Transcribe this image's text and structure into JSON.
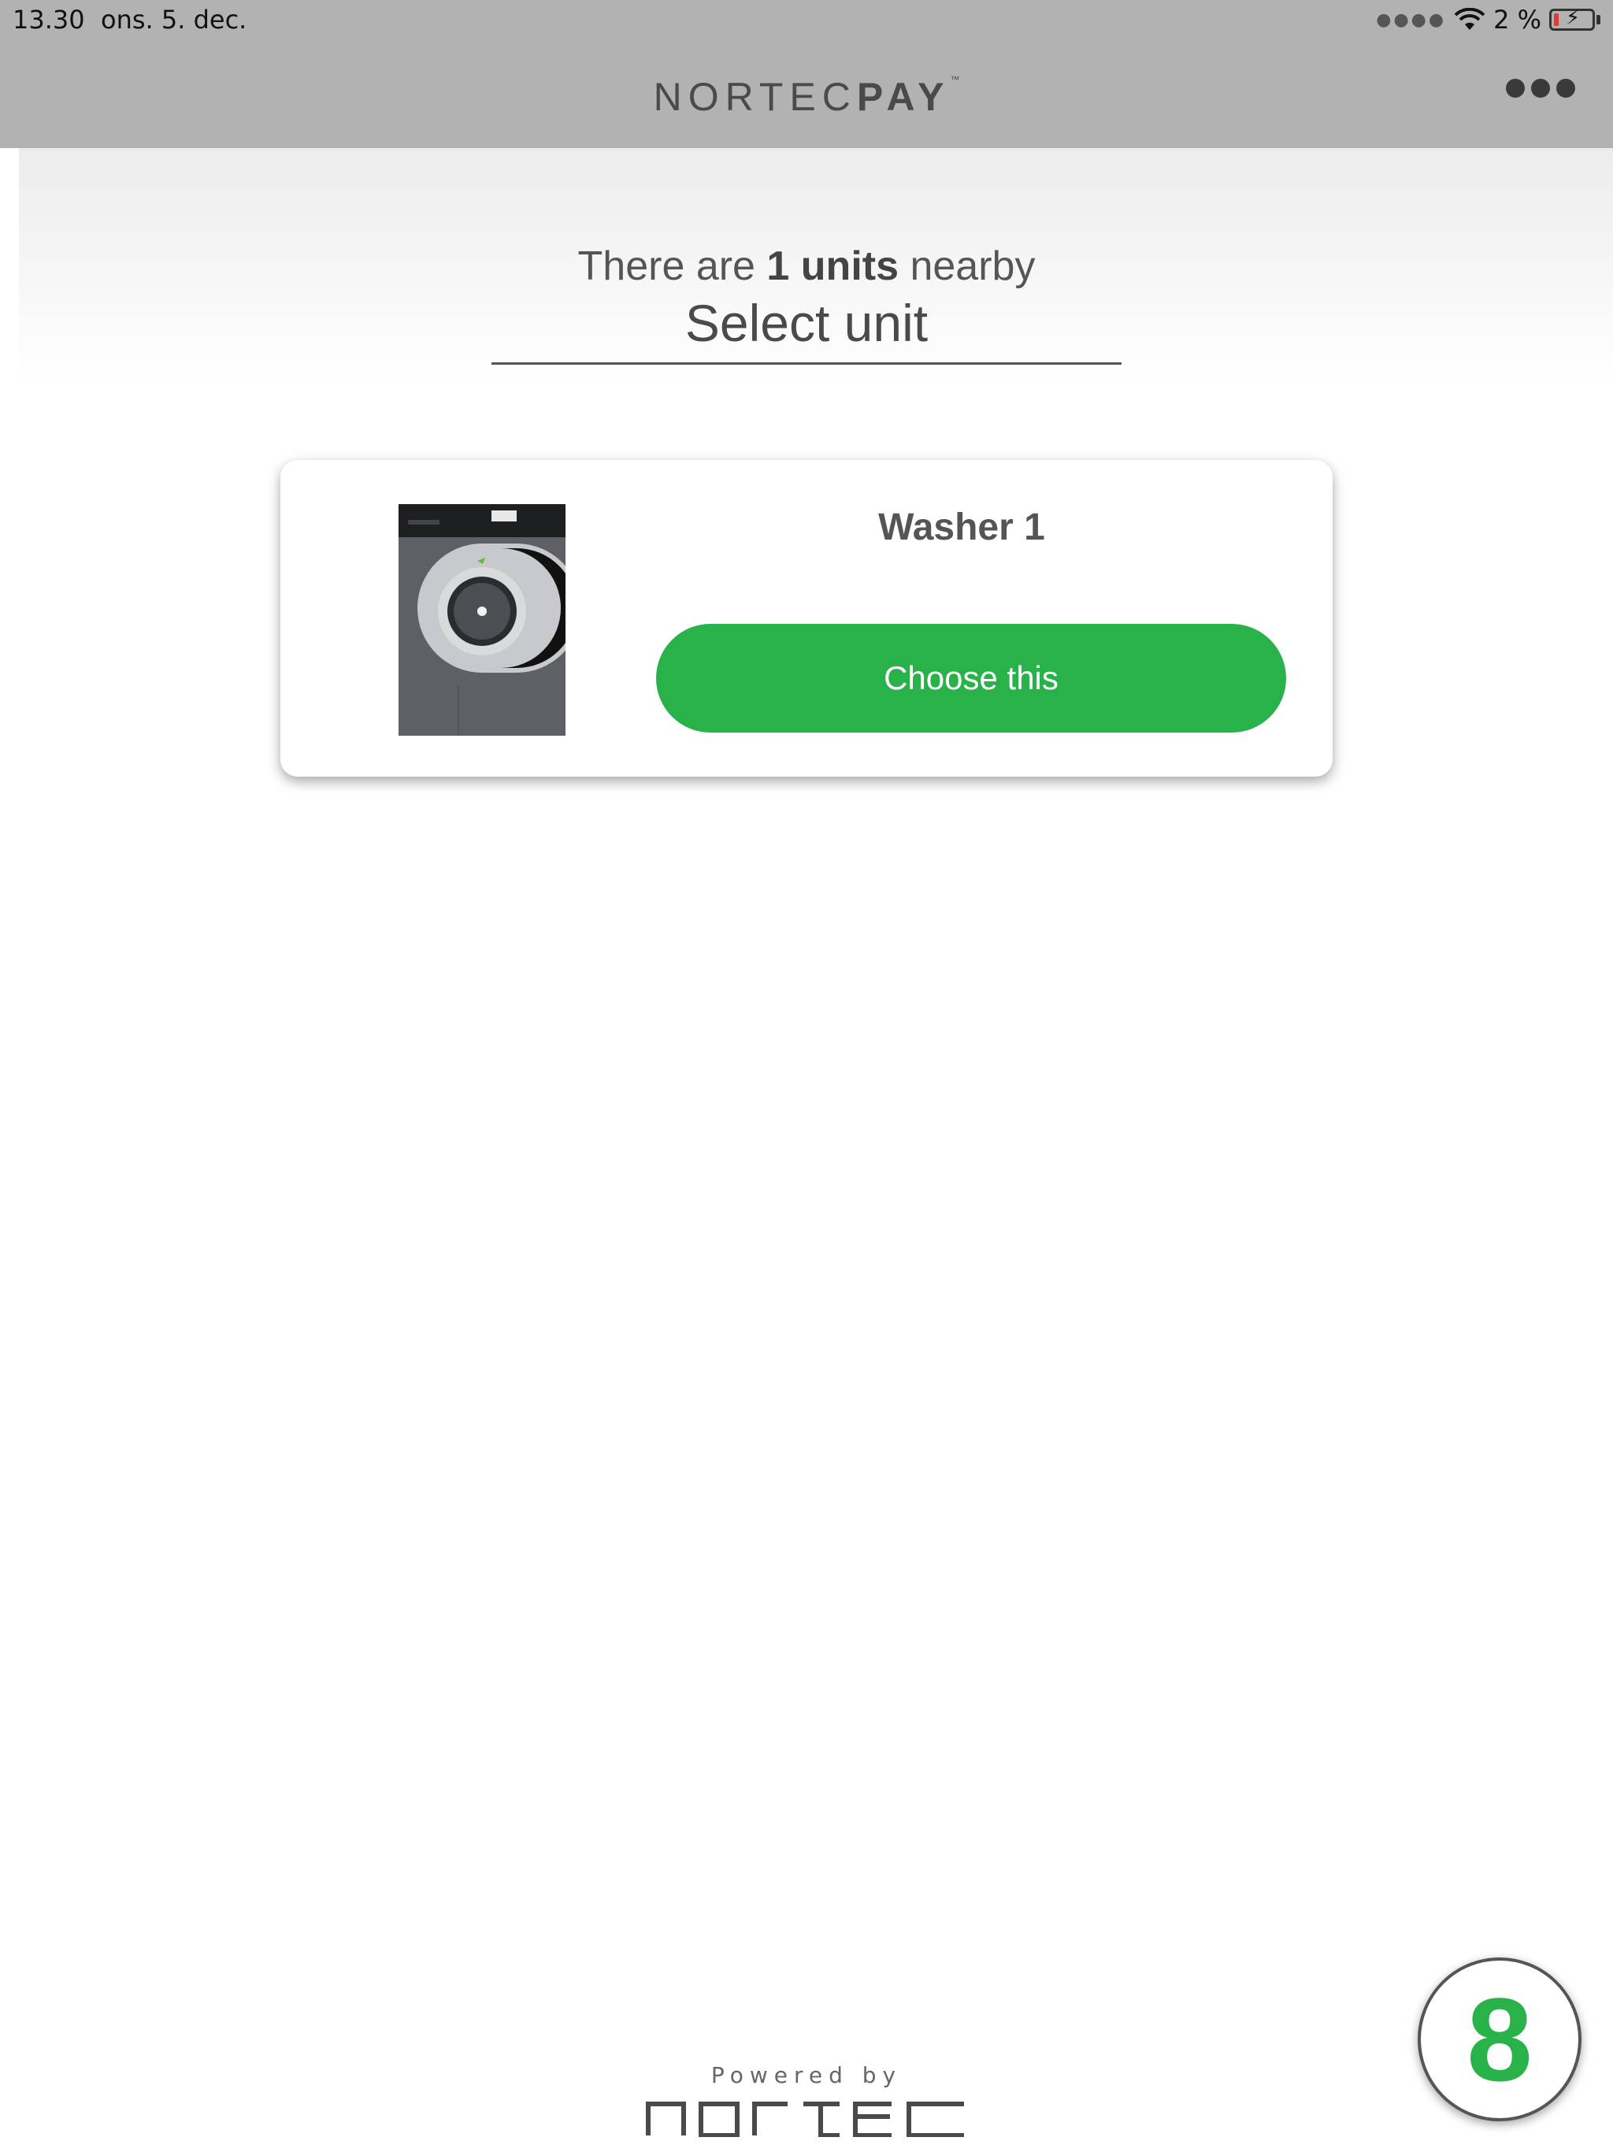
{
  "status_bar": {
    "time": "13.30",
    "date": "ons. 5. dec.",
    "battery_text": "2 %",
    "battery_level": 0.02
  },
  "nav_bar": {
    "brand_light": "NORTEC",
    "brand_bold": "PAY",
    "brand_tm": "™",
    "menu_icon": "ellipsis-icon"
  },
  "header": {
    "nearby_prefix": "There are ",
    "nearby_count": "1 units",
    "nearby_suffix": " nearby",
    "select_label": "Select unit"
  },
  "units": [
    {
      "name": "Washer 1",
      "button_label": "Choose this",
      "icon": "washing-machine-icon"
    }
  ],
  "footer": {
    "powered_by": "Powered by",
    "logo_text": "nortec"
  },
  "badge": {
    "value": "8"
  },
  "colors": {
    "accent_green": "#29b24a",
    "bar_gray": "#b2b2b2"
  }
}
